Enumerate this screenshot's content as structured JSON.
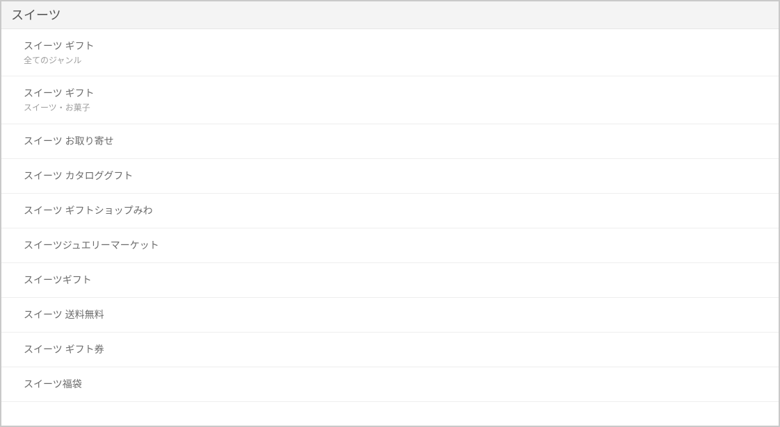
{
  "search": {
    "value": "スイーツ"
  },
  "suggestions": [
    {
      "title": "スイーツ ギフト",
      "sub": "全てのジャンル"
    },
    {
      "title": "スイーツ ギフト",
      "sub": "スイーツ・お菓子"
    },
    {
      "title": "スイーツ お取り寄せ"
    },
    {
      "title": "スイーツ カタロググフト"
    },
    {
      "title": "スイーツ ギフトショップみわ"
    },
    {
      "title": "スイーツジュエリーマーケット"
    },
    {
      "title": "スイーツギフト"
    },
    {
      "title": "スイーツ 送料無料"
    },
    {
      "title": "スイーツ ギフト券"
    },
    {
      "title": "スイーツ福袋"
    }
  ]
}
